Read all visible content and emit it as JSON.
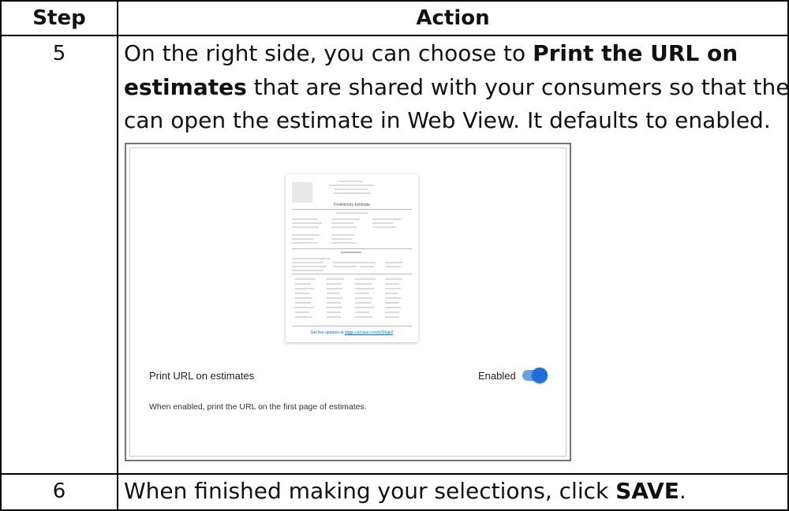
{
  "table": {
    "header": {
      "step": "Step",
      "action": "Action"
    },
    "rows": [
      {
        "step": "5",
        "action": {
          "line1_pre": "On the right side, you can choose to ",
          "line1_bold": "Print the URL on",
          "line2_bold": "estimates",
          "line2_post": " that are shared with your consumers so that they",
          "line3": "can open the estimate in Web View. It defaults to enabled."
        }
      },
      {
        "step": "6",
        "action": {
          "pre": "When finished making your selections, click ",
          "bold": "SAVE",
          "post": "."
        }
      }
    ]
  },
  "screenshot": {
    "preview": {
      "doc_title": "Preliminary Estimate",
      "link_prefix": "Get live updates at ",
      "link_url": "diggs.carcase.com/e/S9gk2"
    },
    "setting": {
      "label": "Print URL on estimates",
      "status": "Enabled",
      "enabled": true,
      "description": "When enabled, print the URL on the first page of estimates."
    },
    "colors": {
      "toggle_track": "#6aa1e4",
      "toggle_knob": "#1f6fd8"
    }
  }
}
